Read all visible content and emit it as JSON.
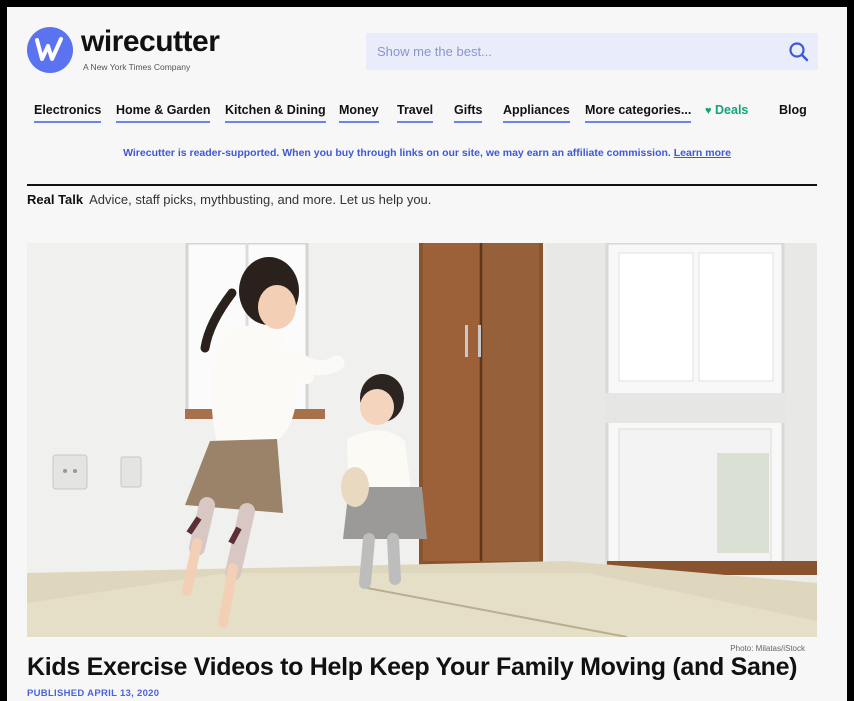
{
  "header": {
    "logo_text": "wirecutter",
    "logo_subtitle": "A New York Times Company",
    "search_placeholder": "Show me the best..."
  },
  "nav": {
    "items": [
      {
        "label": "Electronics"
      },
      {
        "label": "Home & Garden"
      },
      {
        "label": "Kitchen & Dining"
      },
      {
        "label": "Money"
      },
      {
        "label": "Travel"
      },
      {
        "label": "Gifts"
      },
      {
        "label": "Appliances"
      },
      {
        "label": "More categories..."
      },
      {
        "label": "Deals"
      },
      {
        "label": "Blog"
      }
    ]
  },
  "affiliate": {
    "text": "Wirecutter is reader-supported. When you buy through links on our site, we may earn an affiliate commission.",
    "link": "Learn more"
  },
  "section": {
    "name": "Real Talk",
    "tagline": "Advice, staff picks, mythbusting, and more. Let us help you."
  },
  "article": {
    "photo_credit": "Photo: Milatas/iStock",
    "headline": "Kids Exercise Videos to Help Keep Your Family Moving (and Sane)",
    "published": "PUBLISHED APRIL 13, 2020"
  },
  "colors": {
    "brand_blue": "#5b73f0",
    "nav_underline": "#6d84e9",
    "deals_green": "#12a37a",
    "link_blue": "#3f58d6"
  },
  "icons": [
    "wirecutter-logo-icon",
    "search-icon",
    "heart-icon"
  ]
}
